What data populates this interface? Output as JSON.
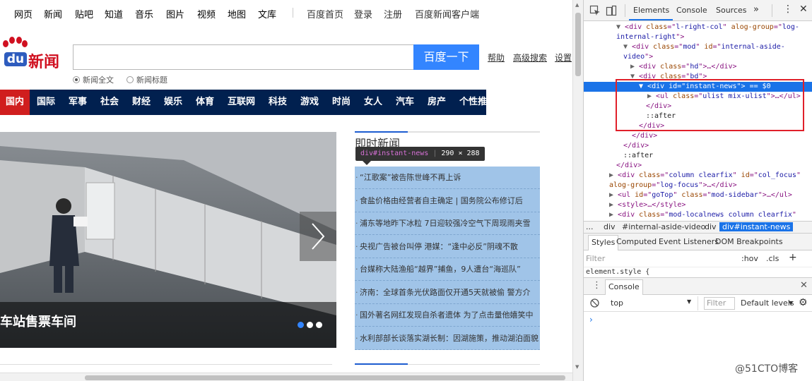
{
  "topnav": {
    "links": [
      "网页",
      "新闻",
      "贴吧",
      "知道",
      "音乐",
      "图片",
      "视频",
      "地图",
      "文库"
    ],
    "right_links": [
      "百度首页",
      "登录",
      "注册",
      "百度新闻客户端"
    ]
  },
  "logo": {
    "du": "du",
    "news": "新闻"
  },
  "search": {
    "value": "",
    "button": "百度一下"
  },
  "side_links": [
    "帮助",
    "高级搜索",
    "设置"
  ],
  "radios": [
    {
      "label": "新闻全文",
      "checked": true
    },
    {
      "label": "新闻标题",
      "checked": false
    }
  ],
  "channels": [
    "国内",
    "国际",
    "军事",
    "社会",
    "财经",
    "娱乐",
    "体育",
    "互联网",
    "科技",
    "游戏",
    "时尚",
    "女人",
    "汽车",
    "房产",
    "个性推"
  ],
  "slider": {
    "caption": "车站售票车间"
  },
  "instant": {
    "heading": "即时新闻",
    "tooltip_tag": "div#instant-news",
    "tooltip_size": "290 × 288",
    "items": [
      "“江歌案”被告陈世峰不再上诉",
      "食盐价格由经营者自主确定 | 国务院公布修订后",
      "浦东等地昨下冰粒 7日迎较强冷空气下周现雨夹雪",
      "央视广告被台叫停 港媒：“逢中必反”阴魂不散",
      "台媒称大陆渔船“越界”捕鱼，9人遭台“海巡队”",
      "济南：全球首条光伏路面仅开通5天就被偷 警方介",
      "国外著名网红发现自杀者遗体 为了点击量他嬉笑中",
      "水利部部长谈落实湖长制：因湖施策，推动湖泊面貌"
    ]
  },
  "devtools": {
    "tabs": [
      "Elements",
      "Console",
      "Sources"
    ],
    "more": "»",
    "dom": [
      {
        "tri": "▼",
        "parts": [
          [
            "tg",
            "<div "
          ],
          [
            "an",
            "class"
          ],
          [
            "tg",
            "=\""
          ],
          [
            "av",
            "l-right-col"
          ],
          [
            "tg",
            "\" "
          ],
          [
            "an",
            "alog-group"
          ],
          [
            "tg",
            "=\""
          ],
          [
            "av",
            "log-"
          ]
        ]
      },
      {
        "tri": "",
        "parts": [
          [
            "av",
            "internal-right"
          ],
          [
            "tg",
            "\">"
          ]
        ]
      },
      {
        "tri": "▼",
        "parts": [
          [
            "tg",
            "<div "
          ],
          [
            "an",
            "class"
          ],
          [
            "tg",
            "=\""
          ],
          [
            "av",
            "mod"
          ],
          [
            "tg",
            "\" "
          ],
          [
            "an",
            "id"
          ],
          [
            "tg",
            "=\""
          ],
          [
            "av",
            "internal-aside-"
          ]
        ]
      },
      {
        "tri": "",
        "parts": [
          [
            "av",
            "video"
          ],
          [
            "tg",
            "\">"
          ]
        ]
      },
      {
        "tri": "▶",
        "parts": [
          [
            "tg",
            "<div "
          ],
          [
            "an",
            "class"
          ],
          [
            "tg",
            "=\""
          ],
          [
            "av",
            "hd"
          ],
          [
            "tg",
            "\">…</div>"
          ]
        ]
      },
      {
        "tri": "▼",
        "parts": [
          [
            "tg",
            "<div "
          ],
          [
            "an",
            "class"
          ],
          [
            "tg",
            "=\""
          ],
          [
            "av",
            "bd"
          ],
          [
            "tg",
            "\">"
          ]
        ]
      },
      {
        "tri": "▼",
        "parts": [
          [
            "tg",
            "<div "
          ],
          [
            "an",
            "id"
          ],
          [
            "tg",
            "=\""
          ],
          [
            "av",
            "instant-news"
          ],
          [
            "tg",
            "\">"
          ],
          [
            "tx",
            " == $0"
          ]
        ]
      },
      {
        "tri": "▶",
        "parts": [
          [
            "tg",
            "<ul "
          ],
          [
            "an",
            "class"
          ],
          [
            "tg",
            "=\""
          ],
          [
            "av",
            "ulist mix-ulist"
          ],
          [
            "tg",
            "\">…</ul>"
          ]
        ]
      },
      {
        "tri": "",
        "parts": [
          [
            "tg",
            "</div>"
          ]
        ]
      },
      {
        "tri": "",
        "parts": [
          [
            "tx",
            "::after"
          ]
        ]
      },
      {
        "tri": "",
        "parts": [
          [
            "tg",
            "</div>"
          ]
        ]
      },
      {
        "tri": "",
        "parts": [
          [
            "tg",
            "</div>"
          ]
        ]
      },
      {
        "tri": "",
        "parts": [
          [
            "tg",
            "</div>"
          ]
        ]
      },
      {
        "tri": "",
        "parts": [
          [
            "tx",
            "::after"
          ]
        ]
      },
      {
        "tri": "",
        "parts": [
          [
            "tg",
            "</div>"
          ]
        ]
      },
      {
        "tri": "▶",
        "parts": [
          [
            "tg",
            "<div "
          ],
          [
            "an",
            "class"
          ],
          [
            "tg",
            "=\""
          ],
          [
            "av",
            "column clearfix"
          ],
          [
            "tg",
            "\" "
          ],
          [
            "an",
            "id"
          ],
          [
            "tg",
            "=\""
          ],
          [
            "av",
            "col_focus"
          ],
          [
            "tg",
            "\""
          ]
        ]
      },
      {
        "tri": "",
        "parts": [
          [
            "an",
            "alog-group"
          ],
          [
            "tg",
            "=\""
          ],
          [
            "av",
            "log-focus"
          ],
          [
            "tg",
            "\">…</div>"
          ]
        ]
      },
      {
        "tri": "▶",
        "parts": [
          [
            "tg",
            "<ul "
          ],
          [
            "an",
            "id"
          ],
          [
            "tg",
            "=\""
          ],
          [
            "av",
            "goTop"
          ],
          [
            "tg",
            "\" "
          ],
          [
            "an",
            "class"
          ],
          [
            "tg",
            "=\""
          ],
          [
            "av",
            "mod-sidebar"
          ],
          [
            "tg",
            "\">…</ul>"
          ]
        ]
      },
      {
        "tri": "▶",
        "parts": [
          [
            "tg",
            "<style>…</style>"
          ]
        ]
      },
      {
        "tri": "▶",
        "parts": [
          [
            "tg",
            "<div "
          ],
          [
            "an",
            "class"
          ],
          [
            "tg",
            "=\""
          ],
          [
            "av",
            "mod-localnews column clearfix"
          ],
          [
            "tg",
            "\""
          ]
        ]
      }
    ],
    "selected_dots": "…",
    "crumbs": [
      "...",
      "div",
      "#internal-aside-video",
      "div",
      "div#instant-news"
    ],
    "subtabs": [
      "Styles",
      "Computed",
      "Event Listeners",
      "DOM Breakpoints"
    ],
    "filter_placeholder": "Filter",
    "hov": ":hov",
    "cls": ".cls",
    "plus": "+",
    "element_style": "element.style {",
    "console_tab": "Console",
    "context": "top",
    "console_filter": "Filter",
    "levels": "Default levels",
    "prompt": "›"
  },
  "watermark": "@51CTO博客"
}
